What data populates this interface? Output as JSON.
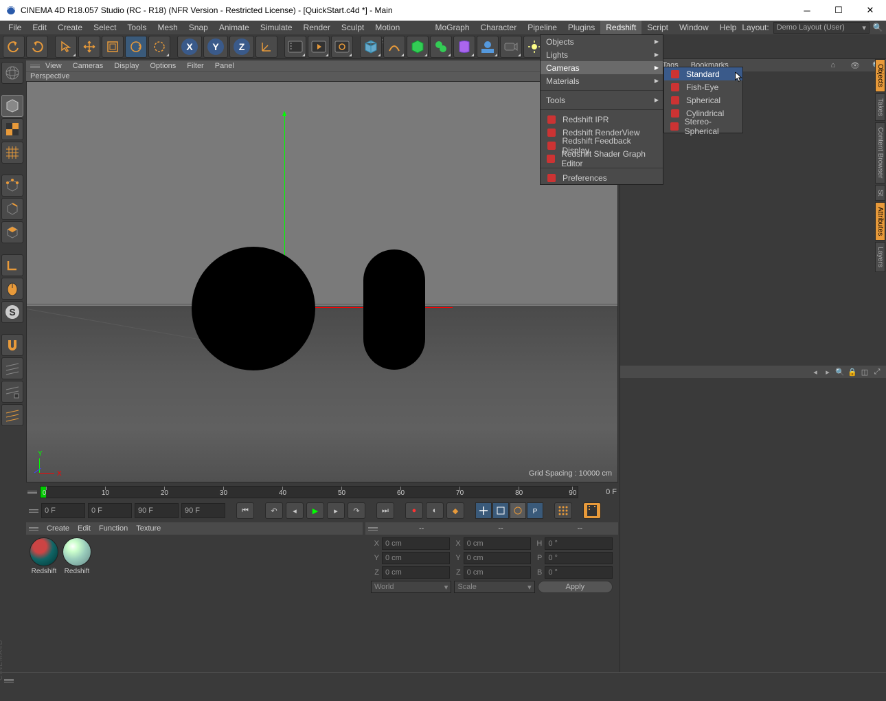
{
  "title": "CINEMA 4D R18.057 Studio (RC - R18)  (NFR Version - Restricted License) - [QuickStart.c4d *] - Main",
  "menubar": [
    "File",
    "Edit",
    "Create",
    "Select",
    "Tools",
    "Mesh",
    "Snap",
    "Animate",
    "Simulate",
    "Render",
    "Sculpt",
    "Motion Tracker",
    "MoGraph",
    "Character",
    "Pipeline",
    "Plugins",
    "Redshift",
    "Script",
    "Window",
    "Help"
  ],
  "layout_label": "Layout:",
  "layout_value": "Demo Layout (User)",
  "viewport_menu": [
    "View",
    "Cameras",
    "Display",
    "Options",
    "Filter",
    "Panel"
  ],
  "viewport_title": "Perspective",
  "grid_spacing": "Grid Spacing : 10000 cm",
  "nav_labels": {
    "x": "X",
    "y": "Y"
  },
  "timeline": {
    "ticks": [
      "0",
      "10",
      "20",
      "30",
      "40",
      "50",
      "60",
      "70",
      "80",
      "90"
    ],
    "end": "0 F"
  },
  "transport": {
    "f1": "0 F",
    "f2": "0 F",
    "f3": "90 F",
    "f4": "90 F"
  },
  "materials": {
    "menu": [
      "Create",
      "Edit",
      "Function",
      "Texture"
    ],
    "items": [
      "Redshift",
      "Redshift"
    ]
  },
  "coord_header_dashes": [
    "--",
    "--",
    "--"
  ],
  "coords": {
    "rows": [
      {
        "l1": "X",
        "v1": "0 cm",
        "l2": "X",
        "v2": "0 cm",
        "l3": "H",
        "v3": "0 °"
      },
      {
        "l1": "Y",
        "v1": "0 cm",
        "l2": "Y",
        "v2": "0 cm",
        "l3": "P",
        "v3": "0 °"
      },
      {
        "l1": "Z",
        "v1": "0 cm",
        "l2": "Z",
        "v2": "0 cm",
        "l3": "B",
        "v3": "0 °"
      }
    ],
    "combo1": "World",
    "combo2": "Scale",
    "apply": "Apply"
  },
  "obj_panel_tabs": [
    "s",
    "Tags",
    "Bookmarks"
  ],
  "vtabs": [
    "Objects",
    "Takes",
    "Content Browser",
    "St",
    "Attributes",
    "Layers"
  ],
  "redshift_menu": {
    "groups": [
      "Objects",
      "Lights",
      "Cameras",
      "Materials"
    ],
    "tools_header": "Tools",
    "tools": [
      "Redshift IPR",
      "Redshift RenderView",
      "Redshift Feedback Display",
      "Redshift Shader Graph Editor"
    ],
    "prefs": "Preferences"
  },
  "camera_submenu": [
    "Standard",
    "Fish-Eye",
    "Spherical",
    "Cylindrical",
    "Stereo-Spherical"
  ]
}
